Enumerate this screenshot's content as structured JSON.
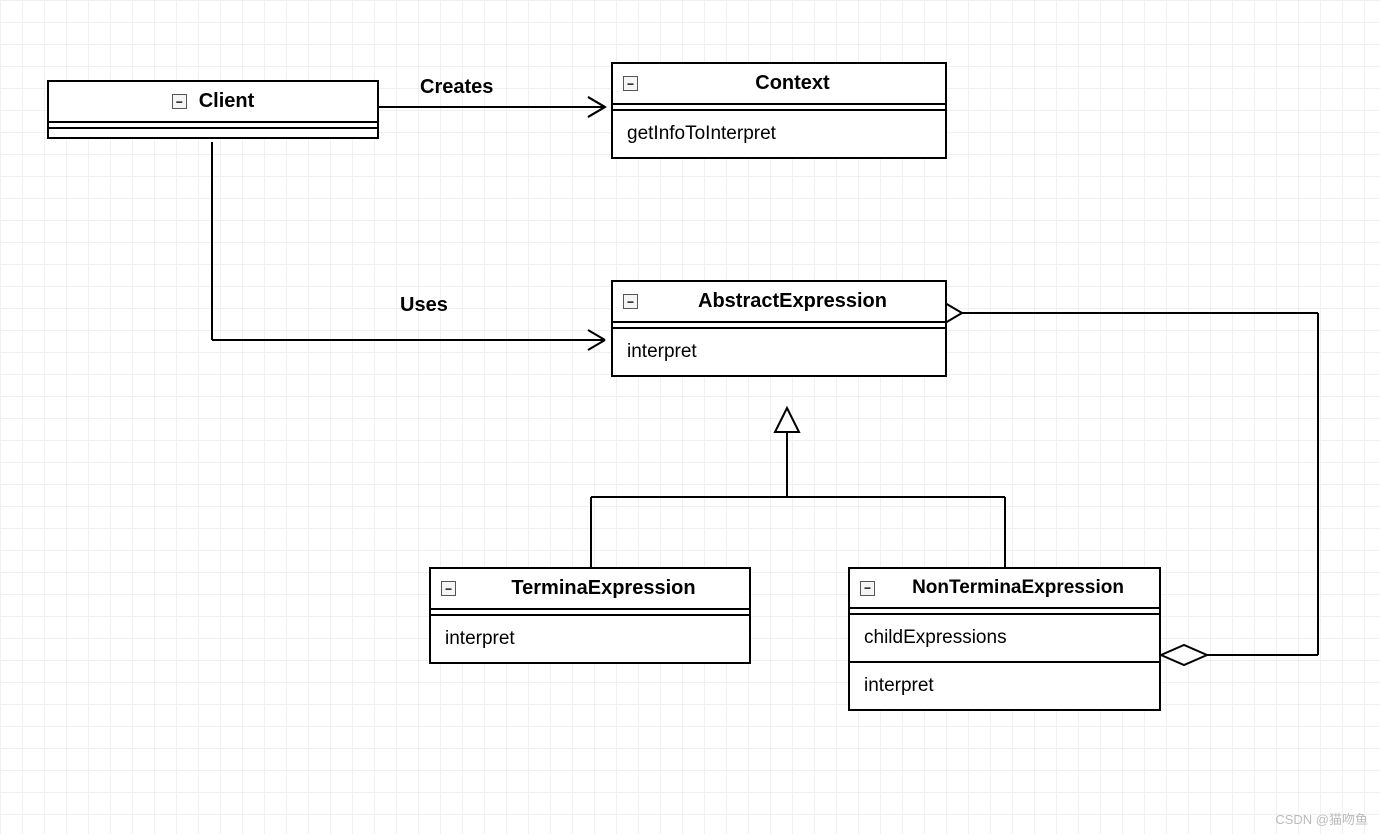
{
  "classes": {
    "client": {
      "name": "Client"
    },
    "context": {
      "name": "Context",
      "methods": [
        "getInfoToInterpret"
      ]
    },
    "abstractExpression": {
      "name": "AbstractExpression",
      "methods": [
        "interpret"
      ]
    },
    "terminalExpression": {
      "name": "TerminaExpression",
      "methods": [
        "interpret"
      ]
    },
    "nonTerminalExpression": {
      "name": "NonTerminaExpression",
      "attributes": [
        "childExpressions"
      ],
      "methods": [
        "interpret"
      ]
    }
  },
  "relations": {
    "creates": "Creates",
    "uses": "Uses"
  },
  "icons": {
    "collapse": "▭"
  },
  "watermark": "CSDN @猫吻鱼"
}
